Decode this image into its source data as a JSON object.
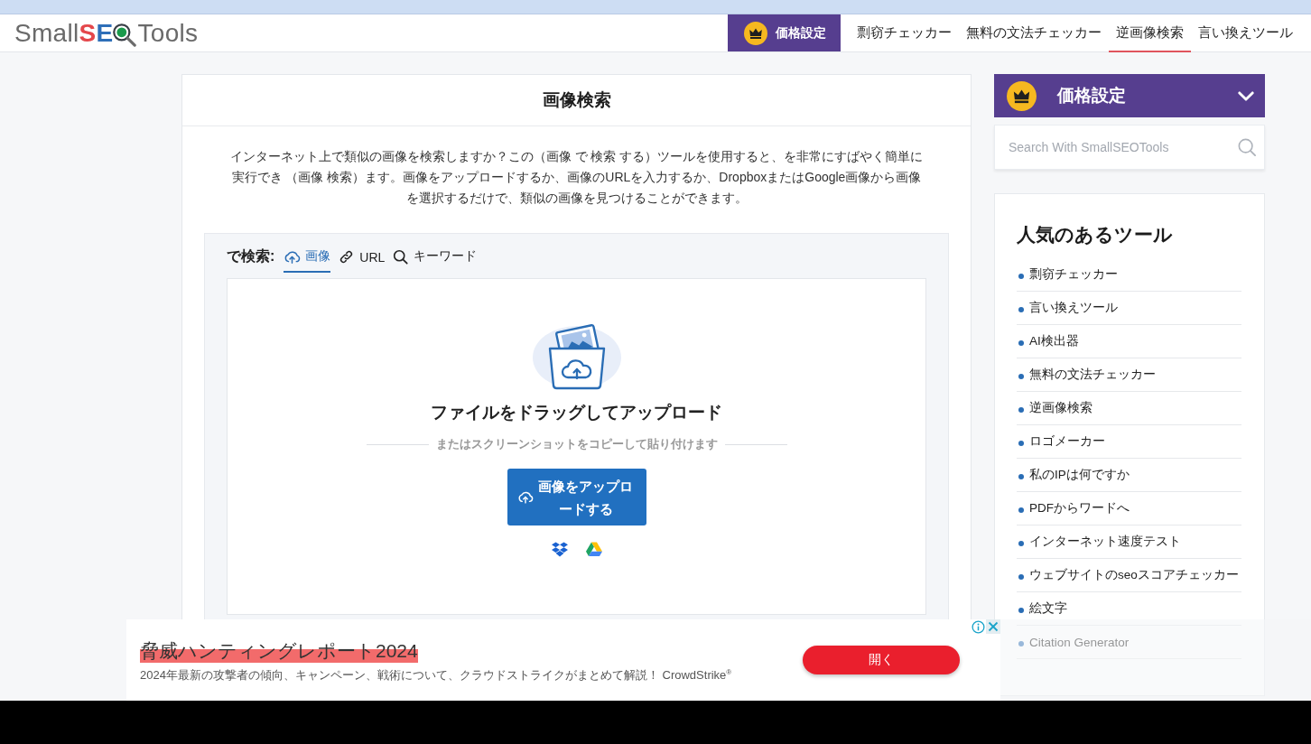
{
  "header": {
    "logo": {
      "text_before": "Small",
      "accent": "SE",
      "text_after": "Tools"
    },
    "pricing_button": "価格設定",
    "nav": [
      {
        "label": "剽窃チェッカー",
        "selected": false
      },
      {
        "label": "無料の文法チェッカー",
        "selected": false
      },
      {
        "label": "逆画像検索",
        "selected": true
      },
      {
        "label": "言い換えツール",
        "selected": false
      }
    ]
  },
  "main": {
    "title": "画像検索",
    "description": "インターネット上で類似の画像を検索しますか？この（画像 で 検索 する）ツールを使用すると、を非常にすばやく簡単に実行でき （画像 検索）ます。画像をアップロードするか、画像のURLを入力するか、DropboxまたはGoogle画像から画像を選択するだけで、類似の画像を見つけることができます。",
    "search_by_label": "で検索:",
    "tabs": [
      {
        "kind": "upload",
        "label": "画像",
        "selected": true
      },
      {
        "kind": "link",
        "label": "URL",
        "selected": false
      },
      {
        "kind": "search",
        "label": "キーワード",
        "selected": false
      }
    ],
    "dropzone": {
      "heading": "ファイルをドラッグしてアップロード",
      "paste_hint": "またはスクリーンショットをコピーして貼り付けます",
      "upload_button": "画像をアップロードする",
      "sources": [
        {
          "kind": "dropbox"
        },
        {
          "kind": "drive"
        }
      ]
    }
  },
  "sidebar": {
    "pricing_dropdown": "価格設定",
    "search": {
      "placeholder": "Search With SmallSEOTools"
    },
    "popular_tools": {
      "title": "人気のあるツール",
      "items": [
        "剽窃チェッカー",
        "言い換えツール",
        "AI検出器",
        "無料の文法チェッカー",
        "逆画像検索",
        "ロゴメーカー",
        "私のIPは何ですか",
        "PDFからワードへ",
        "インターネット速度テスト",
        "ウェブサイトのseoスコアチェッカー",
        "絵文字",
        "Citation Generator"
      ]
    }
  },
  "ad": {
    "title": "脅威ハンティングレポート2024",
    "text": "2024年最新の攻撃者の傾向、キャンペーン、戦術について、クラウドストライクがまとめて解説！ CrowdStrike$^{®}$",
    "button": "開く"
  }
}
